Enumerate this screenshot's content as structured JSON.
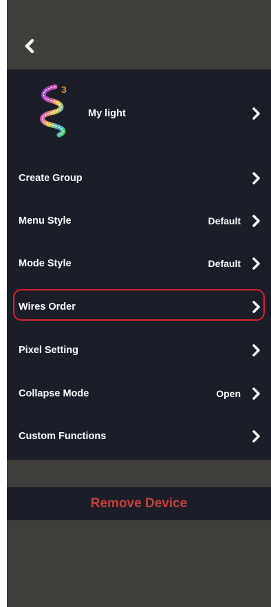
{
  "header": {
    "back_icon": "chevron-left-icon"
  },
  "device": {
    "name": "My light",
    "badge": "3",
    "icon": "led-strip-icon"
  },
  "settings": [
    {
      "label": "Create Group",
      "value": ""
    },
    {
      "label": "Menu Style",
      "value": "Default"
    },
    {
      "label": "Mode Style",
      "value": "Default"
    },
    {
      "label": "Wires Order",
      "value": ""
    },
    {
      "label": "Pixel Setting",
      "value": ""
    },
    {
      "label": "Collapse Mode",
      "value": "Open"
    },
    {
      "label": "Custom Functions",
      "value": ""
    }
  ],
  "highlighted_item": "Wires Order",
  "remove": {
    "label": "Remove Device"
  },
  "colors": {
    "background": "#403e3b",
    "panel": "#1b1d28",
    "text": "#ffffff",
    "highlight_border": "#d8272f",
    "remove_text": "#c8403a",
    "badge": "#e8962e"
  }
}
